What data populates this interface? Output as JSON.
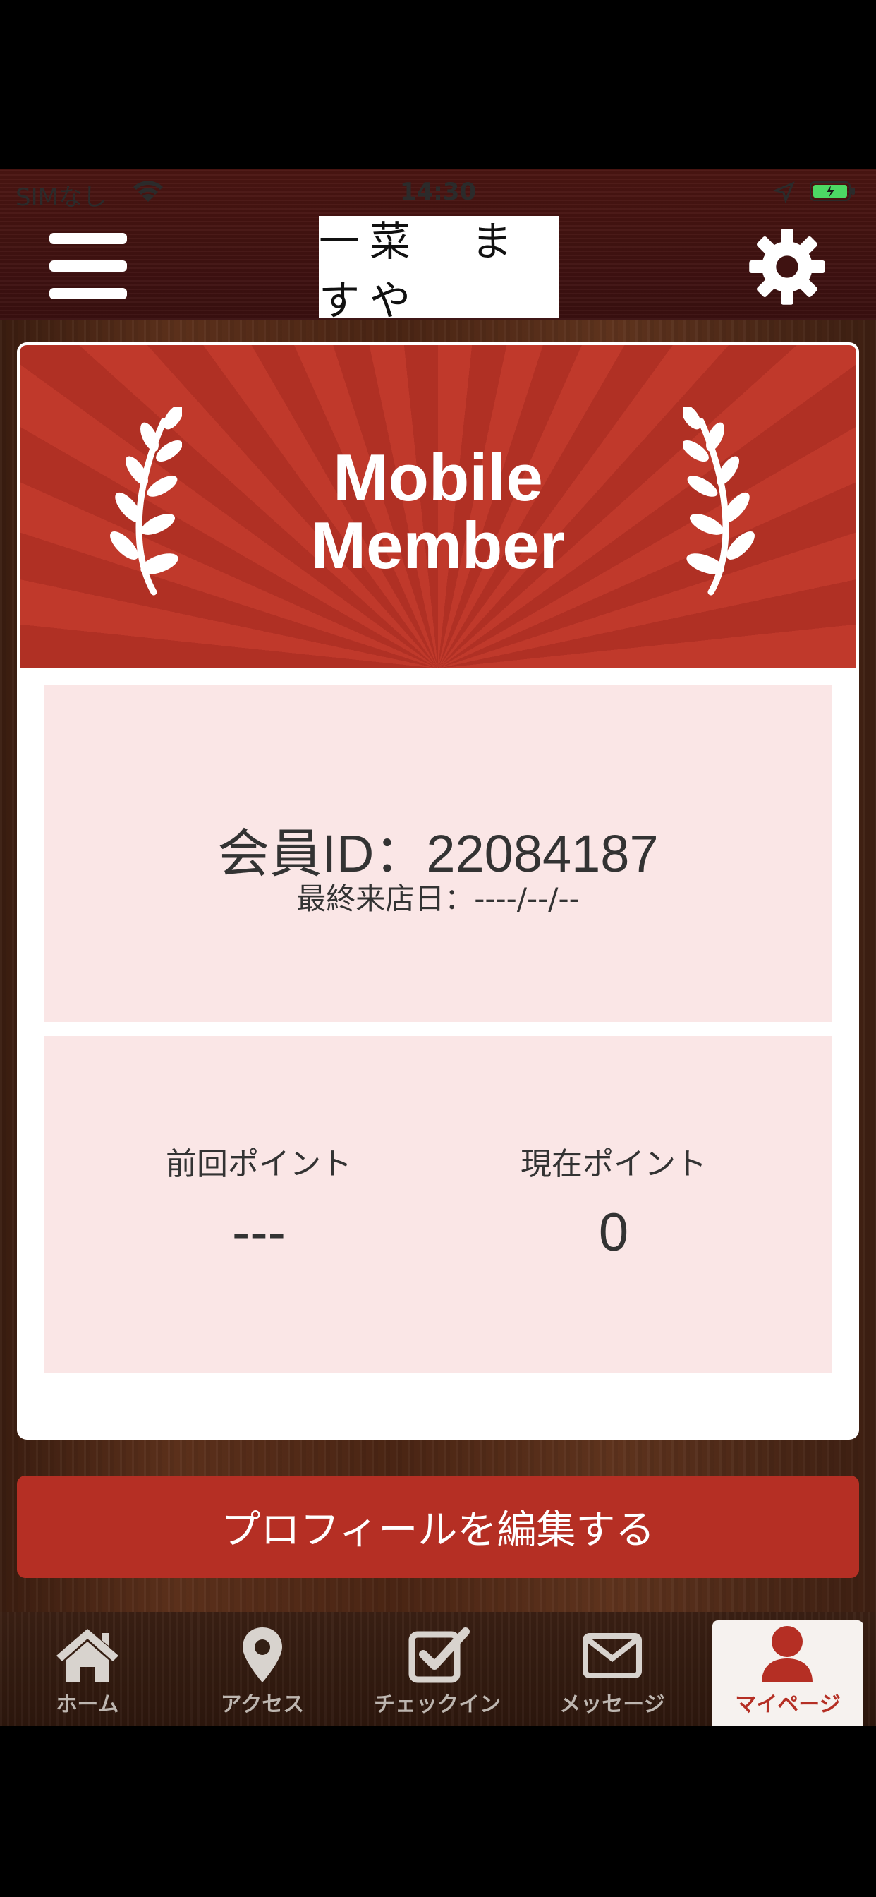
{
  "status_bar": {
    "carrier": "SIMなし",
    "time": "14:30"
  },
  "header": {
    "logo_text": "一菜　ますや"
  },
  "member_card": {
    "banner_title_line1": "Mobile",
    "banner_title_line2": "Member",
    "member_id_text": "会員ID：22084187",
    "last_visit_text": "最終来店日：----/--/--",
    "previous_points_label": "前回ポイント",
    "previous_points_value": "---",
    "current_points_label": "現在ポイント",
    "current_points_value": "0"
  },
  "edit_profile_label": "プロフィールを編集する",
  "tabs": [
    {
      "label": "ホーム",
      "icon": "home-icon",
      "active": false
    },
    {
      "label": "アクセス",
      "icon": "map-pin-icon",
      "active": false
    },
    {
      "label": "チェックイン",
      "icon": "checkin-icon",
      "active": false
    },
    {
      "label": "メッセージ",
      "icon": "envelope-icon",
      "active": false
    },
    {
      "label": "マイページ",
      "icon": "user-icon",
      "active": true
    }
  ],
  "colors": {
    "accent_red": "#b52f24",
    "panel_pink": "#fae6e6",
    "banner_red": "#c0392b"
  }
}
